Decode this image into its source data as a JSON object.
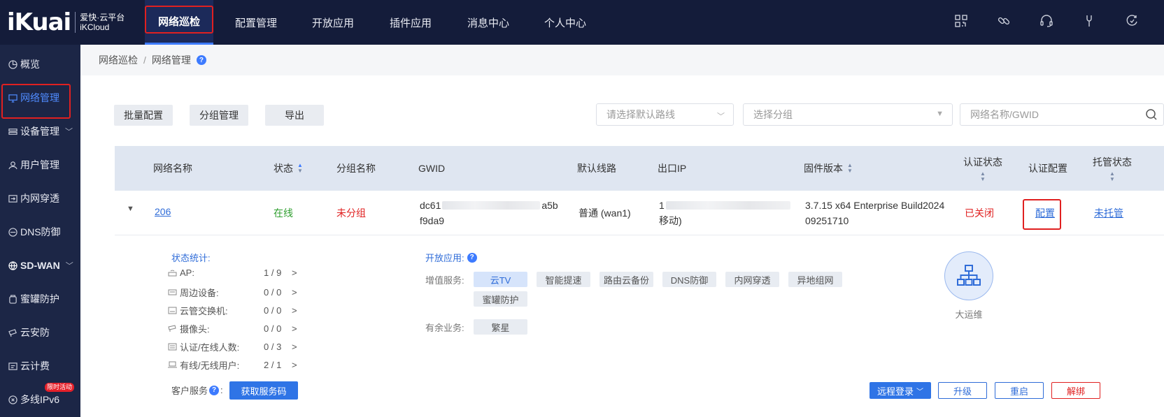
{
  "brand": {
    "mark": "iKuai",
    "line1": "爱快·云平台",
    "line2": "iKCloud"
  },
  "topnav": {
    "items": [
      {
        "label": "网络巡检"
      },
      {
        "label": "配置管理"
      },
      {
        "label": "开放应用"
      },
      {
        "label": "插件应用"
      },
      {
        "label": "消息中心"
      },
      {
        "label": "个人中心"
      }
    ],
    "icons": [
      "qrcode-icon",
      "link-icon",
      "headset-icon",
      "wrench-icon",
      "refresh-settings-icon"
    ]
  },
  "sidebar": {
    "items": [
      {
        "label": "概览",
        "icon": "pie-chart-icon"
      },
      {
        "label": "网络管理",
        "icon": "monitor-icon"
      },
      {
        "label": "设备管理",
        "icon": "device-icon"
      },
      {
        "label": "用户管理",
        "icon": "user-icon"
      },
      {
        "label": "内网穿透",
        "icon": "tunnel-icon"
      },
      {
        "label": "DNS防御",
        "icon": "dns-shield-icon"
      },
      {
        "label": "SD-WAN",
        "icon": "globe-icon"
      },
      {
        "label": "蜜罐防护",
        "icon": "honeypot-icon"
      },
      {
        "label": "云安防",
        "icon": "camera-icon"
      },
      {
        "label": "云计费",
        "icon": "billing-icon"
      },
      {
        "label": "多线IPv6",
        "icon": "ipv6-icon",
        "badge": "限时活动"
      }
    ]
  },
  "breadcrumb": {
    "root": "网络巡检",
    "current": "网络管理",
    "help": "?"
  },
  "toolbar": {
    "batch_config": "批量配置",
    "group_manage": "分组管理",
    "export": "导出",
    "route_placeholder": "请选择默认路线",
    "group_placeholder": "选择分组",
    "search_placeholder": "网络名称/GWID"
  },
  "table": {
    "headers": {
      "name": "网络名称",
      "status": "状态",
      "group": "分组名称",
      "gwid": "GWID",
      "route": "默认线路",
      "ip": "出口IP",
      "firmware": "固件版本",
      "auth_status": "认证状态",
      "auth_config": "认证配置",
      "hosting": "托管状态"
    },
    "row": {
      "name": "206",
      "status": "在线",
      "group": "未分组",
      "gwid_line1_start": "dc61",
      "gwid_line1_end": "a5b",
      "gwid_line2": "f9da9",
      "route": "普通 (wan1)",
      "ip_line1": "1",
      "ip_line2": "移动)",
      "firmware_line1": "3.7.15 x64 Enterprise Build2024",
      "firmware_line2": "09251710",
      "auth_status": "已关闭",
      "auth_config": "配置",
      "hosting": "未托管"
    }
  },
  "details": {
    "stats_title": "状态统计:",
    "stats": [
      {
        "label": "AP:",
        "value": "1 / 9",
        "icon": "ap-icon"
      },
      {
        "label": "周边设备:",
        "value": "0 / 0",
        "icon": "peripheral-icon"
      },
      {
        "label": "云管交换机:",
        "value": "0 / 0",
        "icon": "switch-icon"
      },
      {
        "label": "摄像头:",
        "value": "0 / 0",
        "icon": "camera-icon"
      },
      {
        "label": "认证/在线人数:",
        "value": "0 / 3",
        "icon": "auth-icon"
      },
      {
        "label": "有线/无线用户:",
        "value": "2 / 1",
        "icon": "laptop-icon"
      }
    ],
    "arrow": ">",
    "open_apps_title": "开放应用:",
    "value_added_label": "增值服务:",
    "value_added": [
      "云TV",
      "智能提速",
      "路由云备份",
      "DNS防御",
      "内网穿透",
      "异地组网",
      "蜜罐防护"
    ],
    "surplus_label": "有余业务:",
    "surplus": [
      "繁星"
    ],
    "ops_label": "大运维",
    "customer_service_label": "客户服务",
    "get_code_button": "获取服务码",
    "remote_login": "远程登录",
    "upgrade": "升级",
    "restart": "重启",
    "unbind": "解绑"
  },
  "colors": {
    "nav_bg": "#141c3a",
    "sidebar_bg": "#1c2646",
    "accent": "#3d7bff",
    "online": "#2e9e2e",
    "danger": "#e02020"
  }
}
